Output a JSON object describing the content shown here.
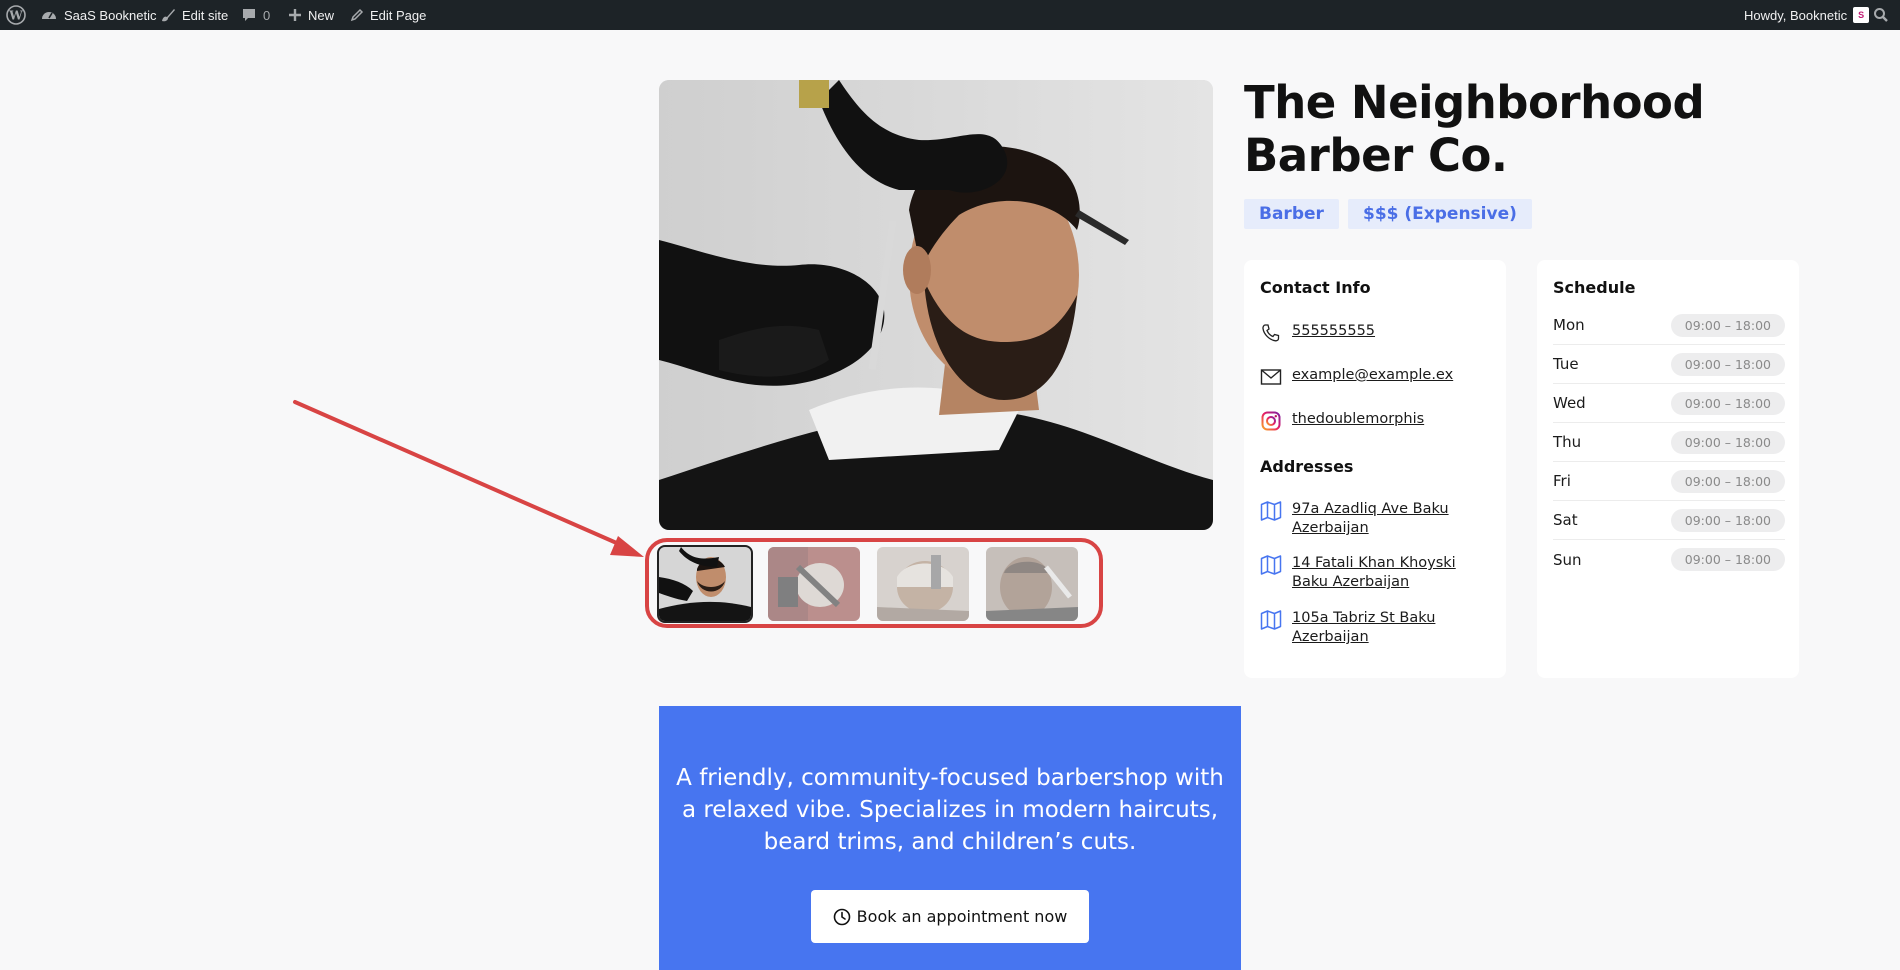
{
  "adminbar": {
    "site_name": "SaaS Booknetic",
    "edit_site": "Edit site",
    "comments_count": "0",
    "new_label": "New",
    "edit_page": "Edit Page",
    "howdy": "Howdy, Booknetic"
  },
  "business": {
    "title": "The Neighborhood Barber Co.",
    "tags": [
      "Barber",
      "$$$ (Expensive)"
    ],
    "description": "A friendly, community-focused barbershop with a relaxed vibe. Specializes in modern haircuts, beard trims, and children’s cuts.",
    "book_button": "Book an appointment now"
  },
  "contact": {
    "heading": "Contact Info",
    "phone": "555555555",
    "email": "example@example.ex",
    "instagram": "thedoublemorphis"
  },
  "addresses": {
    "heading": "Addresses",
    "items": [
      "97a Azadliq Ave Baku Azerbaijan",
      "14 Fatali Khan Khoyski Baku Azerbaijan",
      "105a Tabriz St Baku Azerbaijan"
    ]
  },
  "schedule": {
    "heading": "Schedule",
    "days": [
      {
        "day": "Mon",
        "hours": "09:00 – 18:00"
      },
      {
        "day": "Tue",
        "hours": "09:00 – 18:00"
      },
      {
        "day": "Wed",
        "hours": "09:00 – 18:00"
      },
      {
        "day": "Thu",
        "hours": "09:00 – 18:00"
      },
      {
        "day": "Fri",
        "hours": "09:00 – 18:00"
      },
      {
        "day": "Sat",
        "hours": "09:00 – 18:00"
      },
      {
        "day": "Sun",
        "hours": "09:00 – 18:00"
      }
    ]
  },
  "colors": {
    "accent_blue": "#4775f0",
    "tag_bg": "#e6ecfb",
    "tag_text": "#4a6ee6",
    "annotation_red": "#d84444",
    "adminbar_bg": "#1d2327"
  },
  "gallery": {
    "thumbnail_count": 4,
    "active_index": 0
  }
}
